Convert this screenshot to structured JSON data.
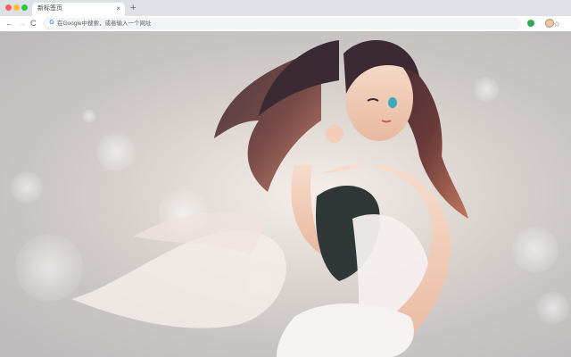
{
  "browser": {
    "tab": {
      "title": "新标签页",
      "close_glyph": "×"
    },
    "new_tab_glyph": "+",
    "nav": {
      "back_glyph": "←",
      "forward_glyph": "→",
      "reload_glyph": "C"
    },
    "omnibox": {
      "engine_glyph": "G",
      "placeholder": "在Google中搜索，或者输入一个网址"
    },
    "star_glyph": "☆",
    "menu_glyph": "⋮"
  },
  "colors": {
    "tabstrip": "#dee1e6",
    "toolbar": "#ffffff",
    "omnibox": "#f1f3f4",
    "extension": "#34a853"
  },
  "icons": [
    "back-arrow-icon",
    "forward-arrow-icon",
    "reload-icon",
    "google-icon",
    "star-icon",
    "extension-icon",
    "avatar-icon",
    "menu-dots-icon"
  ]
}
